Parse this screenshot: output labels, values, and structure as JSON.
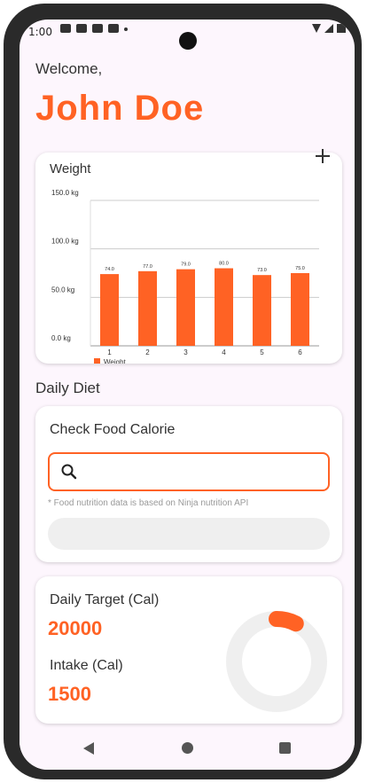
{
  "status_bar": {
    "time": "1:00"
  },
  "welcome": {
    "greeting": "Welcome,",
    "user_name": "John Doe"
  },
  "weight_card": {
    "title": "Weight",
    "add_icon": "plus-icon"
  },
  "chart_data": {
    "type": "bar",
    "categories": [
      "1",
      "2",
      "3",
      "4",
      "5",
      "6"
    ],
    "series": [
      {
        "name": "Weight",
        "values": [
          74.0,
          77.0,
          79.0,
          80.0,
          73.0,
          75.0
        ]
      }
    ],
    "value_labels": [
      "74.0",
      "77.0",
      "79.0",
      "80.0",
      "73.0",
      "75.0"
    ],
    "y_ticks": [
      "0.0 kg",
      "50.0 kg",
      "100.0 kg",
      "150.0 kg"
    ],
    "y_tick_values": [
      0,
      50,
      100,
      150
    ],
    "ylim": [
      0,
      150
    ],
    "legend": "bottom-left",
    "grid": true,
    "color": "#ff6224"
  },
  "daily_diet": {
    "section_title": "Daily Diet",
    "food_card": {
      "title": "Check Food Calorie",
      "search_value": "",
      "note": "* Food nutrition data is based on Ninja nutrition API"
    }
  },
  "calorie_card": {
    "target_label": "Daily Target (Cal)",
    "target_value": "20000",
    "intake_label": "Intake (Cal)",
    "intake_value": "1500",
    "intake_fraction": 0.075
  },
  "colors": {
    "accent": "#ff6224",
    "background": "#fdf6fd",
    "ring_track": "#efefef"
  }
}
